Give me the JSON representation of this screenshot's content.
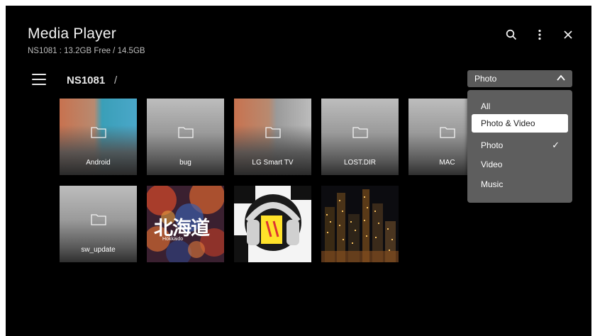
{
  "app": {
    "title": "Media Player",
    "storage_info": "NS1081 : 13.2GB Free / 14.5GB"
  },
  "header_icons": [
    "search-icon",
    "more-vert-icon",
    "close-icon"
  ],
  "breadcrumb": {
    "current": "NS1081",
    "separator": "/"
  },
  "filter": {
    "selected": "Photo",
    "options": [
      {
        "label": "All",
        "focused": false,
        "checked": false
      },
      {
        "label": "Photo & Video",
        "focused": true,
        "checked": false
      },
      {
        "label": "Photo",
        "focused": false,
        "checked": true
      },
      {
        "label": "Video",
        "focused": false,
        "checked": false
      },
      {
        "label": "Music",
        "focused": false,
        "checked": false
      }
    ],
    "check_mark": "✓"
  },
  "grid": {
    "folders": [
      {
        "label": "Android"
      },
      {
        "label": "bug"
      },
      {
        "label": "LG Smart TV"
      },
      {
        "label": "LOST.DIR"
      },
      {
        "label": "MAC"
      },
      {
        "label": "sw_update"
      }
    ],
    "photos": [
      {
        "name": "hokkaido-photo",
        "text": "北海道",
        "subtext": "Hokkaido"
      },
      {
        "name": "headphones-photo"
      },
      {
        "name": "city-night-photo"
      }
    ]
  },
  "colors": {
    "background": "#000000",
    "dropdown": "#5e5e5e",
    "focus": "#ffffff"
  }
}
